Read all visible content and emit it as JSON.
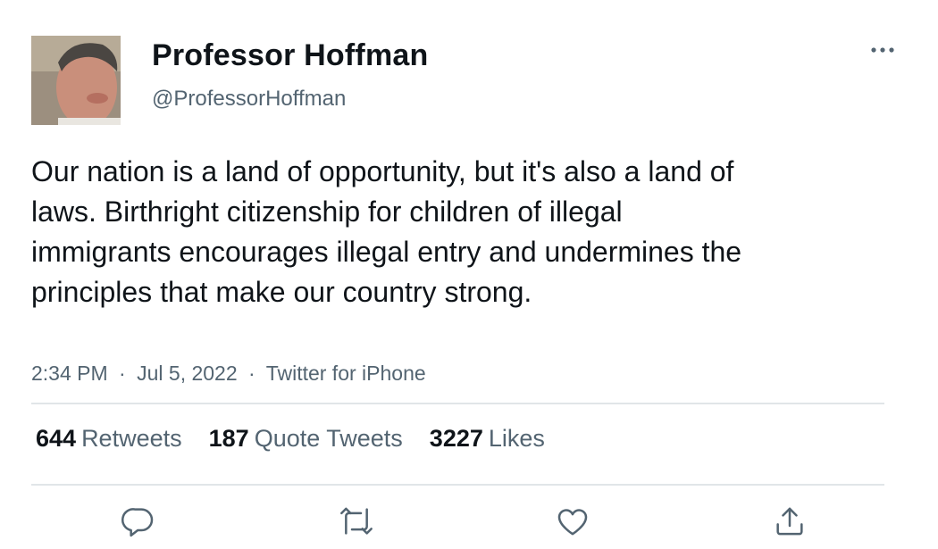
{
  "author": {
    "display_name": "Professor Hoffman",
    "handle": "@ProfessorHoffman",
    "avatar_icon": "profile-photo"
  },
  "tweet": {
    "text": "Our nation is a land of opportunity, but it's also a land of laws. Birthright citizenship for children of illegal immigrants encourages illegal entry and undermines the principles that make our country strong.",
    "time": "2:34 PM",
    "date": "Jul 5, 2022",
    "source": "Twitter for iPhone",
    "separator": "·"
  },
  "stats": {
    "retweets": {
      "count": "644",
      "label": "Retweets"
    },
    "quote_tweets": {
      "count": "187",
      "label": "Quote Tweets"
    },
    "likes": {
      "count": "3227",
      "label": "Likes"
    }
  },
  "icons": {
    "more": "more-horizontal-icon",
    "reply": "reply-icon",
    "retweet": "retweet-icon",
    "like": "heart-icon",
    "share": "share-icon"
  },
  "colors": {
    "text_primary": "#0f1419",
    "text_secondary": "#536471",
    "divider": "#e1e5e8"
  }
}
